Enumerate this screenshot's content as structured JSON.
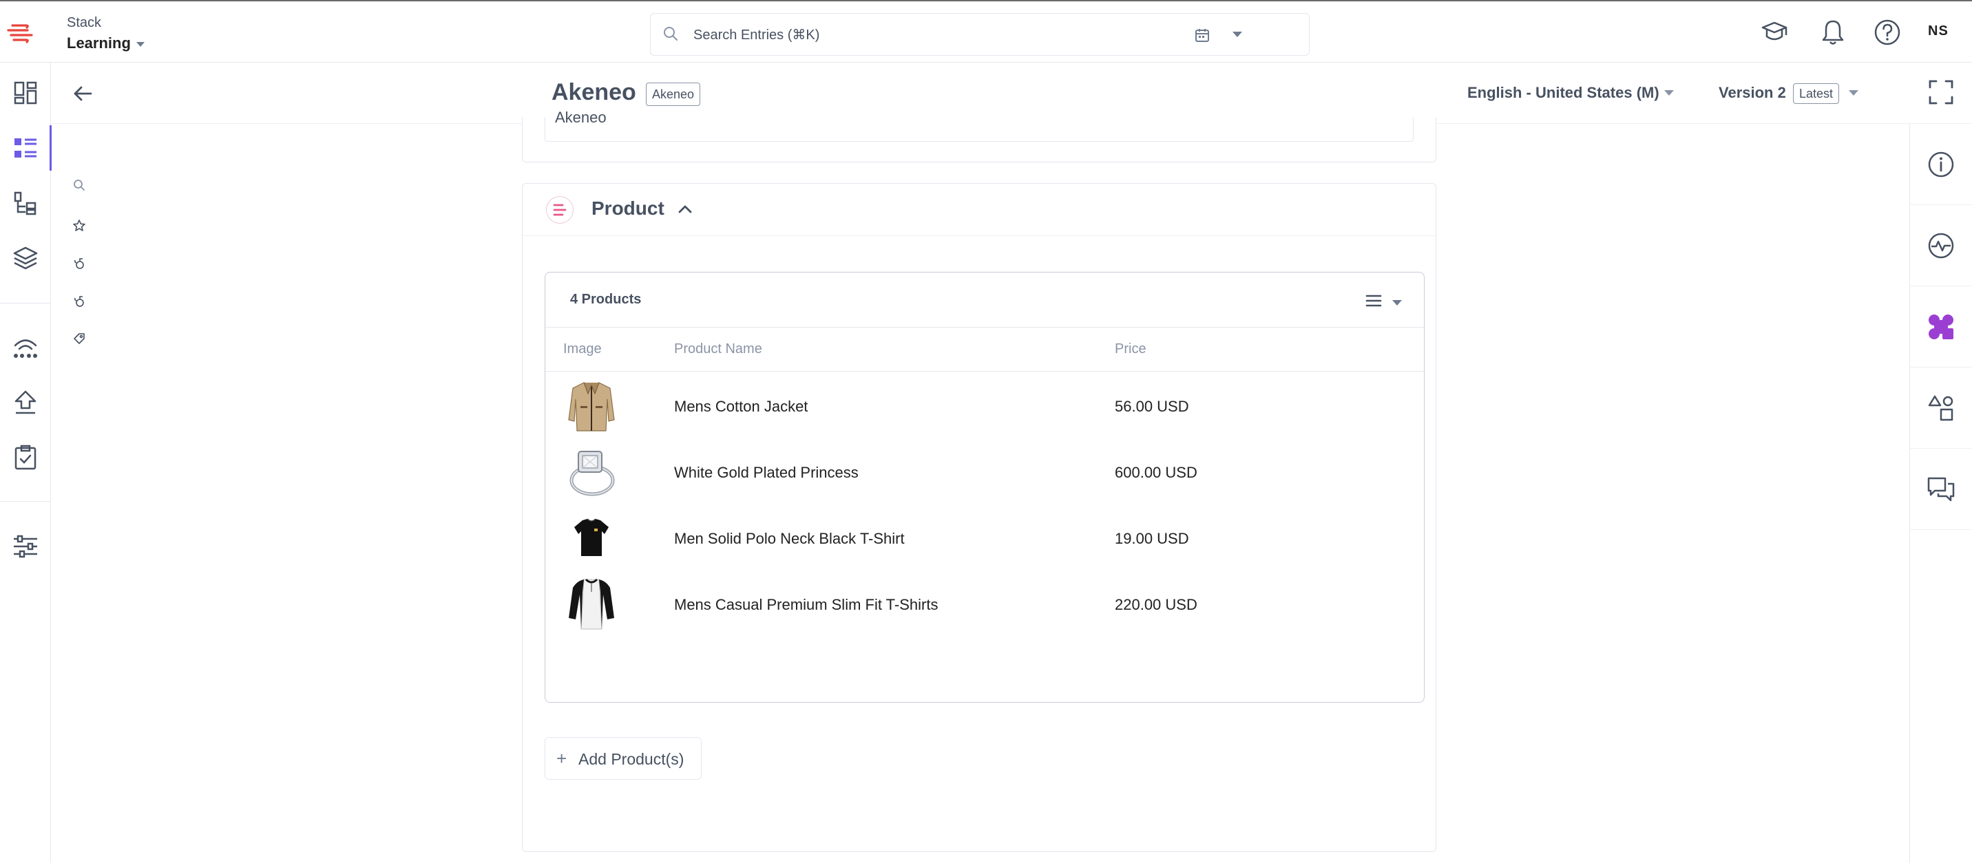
{
  "header": {
    "stack_name": "Stack",
    "branch_name": "Learning",
    "search_placeholder": "Search Entries (⌘K)",
    "user_initials": "NS"
  },
  "entry": {
    "title": "Akeneo",
    "content_type_tag": "Akeneo",
    "locale": "English - United States (M)",
    "version": "Version 2",
    "version_tag": "Latest",
    "title_field_value": "Akeneo"
  },
  "product_field": {
    "label": "Product",
    "count_label": "4 Products",
    "columns": [
      "Image",
      "Product Name",
      "Price"
    ],
    "rows": [
      {
        "name": "Mens Cotton Jacket",
        "price": "56.00 USD",
        "image": "jacket-thumbnail"
      },
      {
        "name": "White Gold Plated Princess",
        "price": "600.00 USD",
        "image": "ring-thumbnail"
      },
      {
        "name": "Men Solid Polo Neck Black T-Shirt",
        "price": "19.00 USD",
        "image": "black-tshirt-thumbnail"
      },
      {
        "name": "Mens Casual Premium Slim Fit T-Shirts",
        "price": "220.00 USD",
        "image": "raglan-tshirt-thumbnail"
      }
    ],
    "add_button_label": "Add Product(s)"
  },
  "colors": {
    "accent": "#6c5ce7",
    "text_muted": "#475161",
    "border": "#e4e7ee",
    "logo_red": "#e8453c",
    "ref_icon_pink": "#e8588a"
  }
}
